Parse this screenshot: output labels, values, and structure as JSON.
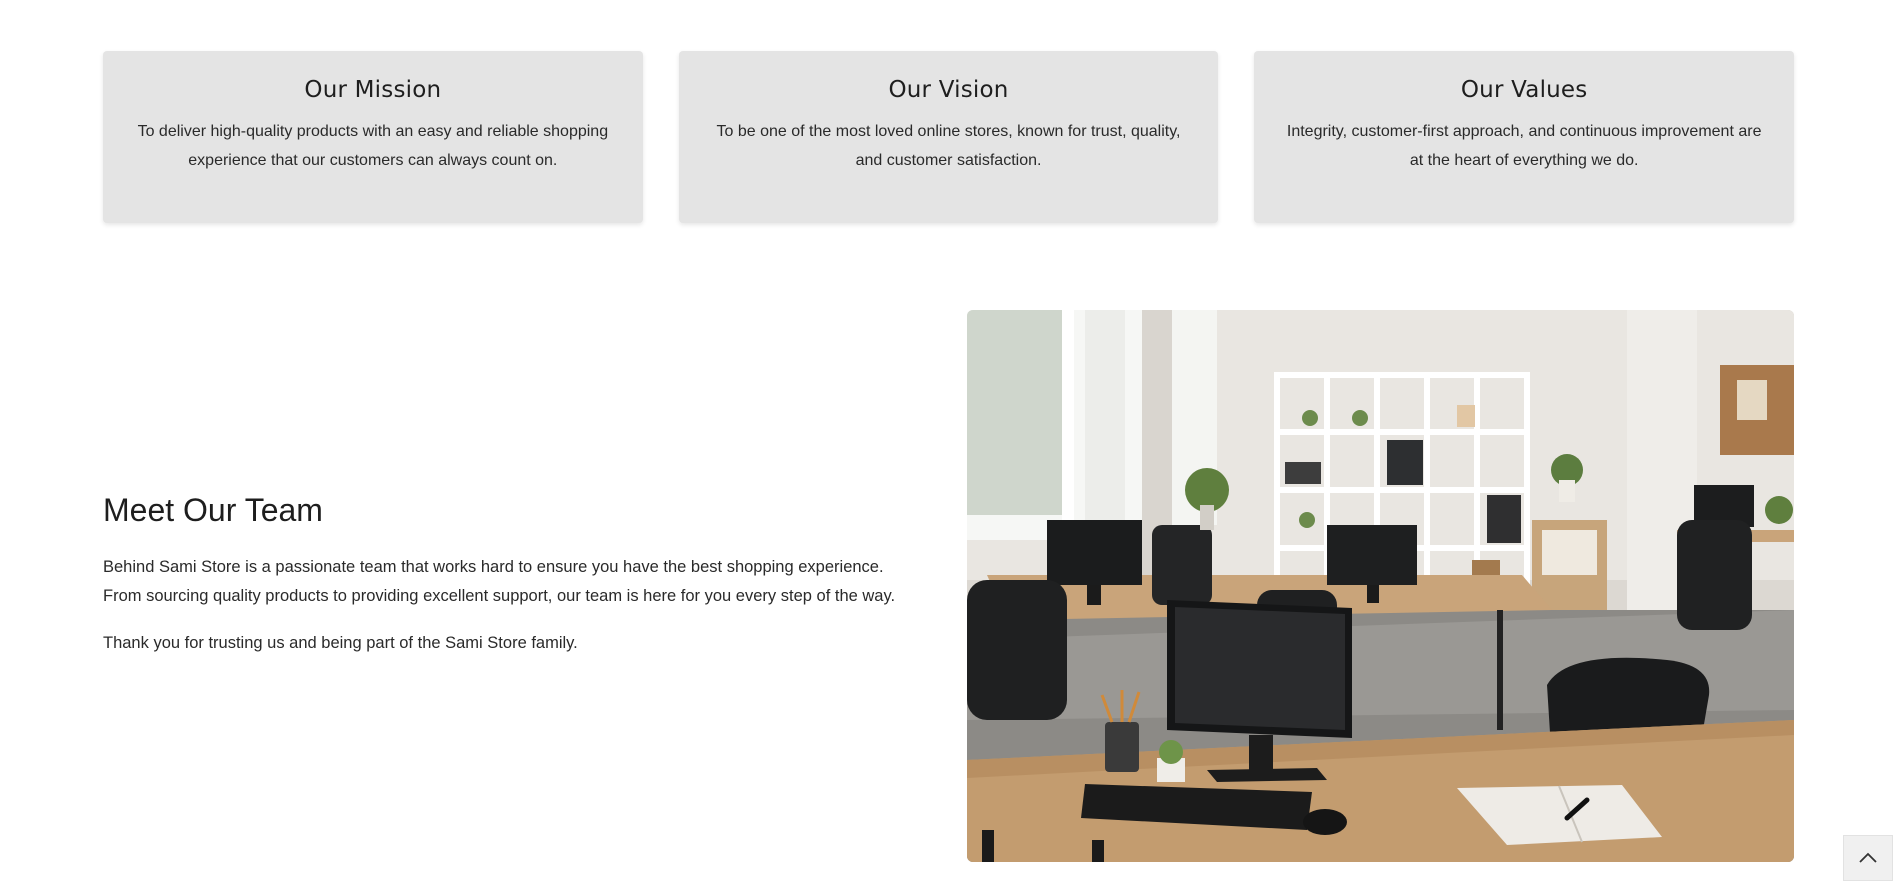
{
  "cards": [
    {
      "title": "Our Mission",
      "text": "To deliver high-quality products with an easy and reliable shopping experience that our customers can always count on."
    },
    {
      "title": "Our Vision",
      "text": "To be one of the most loved online stores, known for trust, quality, and customer satisfaction."
    },
    {
      "title": "Our Values",
      "text": "Integrity, customer-first approach, and continuous improvement are at the heart of everything we do."
    }
  ],
  "team": {
    "title": "Meet Our Team",
    "paragraph_1": "Behind Sami Store is a passionate team that works hard to ensure you have the best shopping experience. From sourcing quality products to providing excellent support, our team is here for you every step of the way.",
    "paragraph_2": "Thank you for trusting us and being part of the Sami Store family."
  },
  "image": {
    "icon": "office-photo"
  },
  "back_to_top": {
    "icon": "chevron-up-icon"
  }
}
